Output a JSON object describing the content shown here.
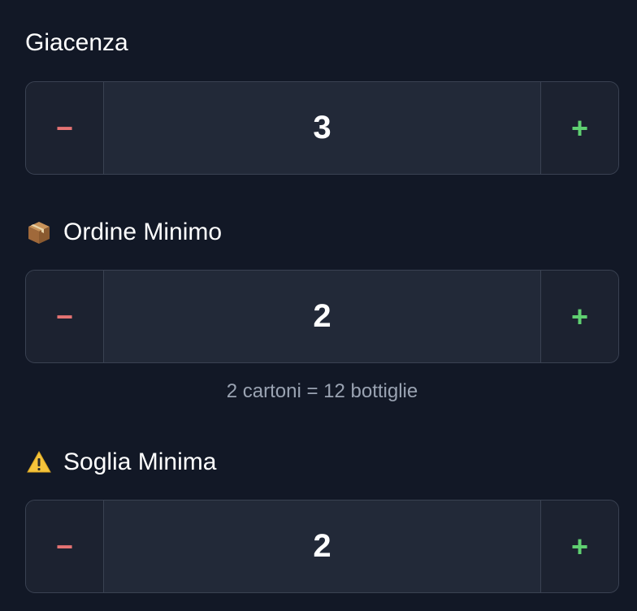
{
  "fields": [
    {
      "label": "Giacenza",
      "icon": "",
      "value": "3",
      "decrement_symbol": "−",
      "increment_symbol": "+"
    },
    {
      "label": "Ordine Minimo",
      "icon": "package-icon",
      "value": "2",
      "decrement_symbol": "−",
      "increment_symbol": "+",
      "helper": "2 cartoni = 12 bottiglie"
    },
    {
      "label": "Soglia Minima",
      "icon": "warning-icon",
      "value": "2",
      "decrement_symbol": "−",
      "increment_symbol": "+"
    }
  ],
  "colors": {
    "background": "#121826",
    "stepper_bg": "#1e2433",
    "border": "#3a4252",
    "decrement": "#e57373",
    "increment": "#5fd071",
    "helper_text": "#9aa3b2"
  }
}
